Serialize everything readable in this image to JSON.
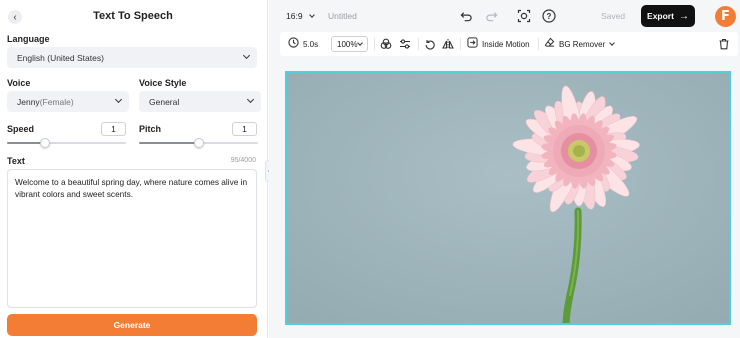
{
  "panel": {
    "title": "Text To Speech",
    "language_label": "Language",
    "language_value": "English (United States)",
    "voice_label": "Voice",
    "voice_name": "Jenny",
    "voice_gender": "(Female)",
    "voice_style_label": "Voice Style",
    "voice_style_value": "General",
    "speed_label": "Speed",
    "speed_value": "1",
    "pitch_label": "Pitch",
    "pitch_value": "1",
    "speed_level": 0.32,
    "pitch_level": 0.5,
    "text_label": "Text",
    "text_counter": "95/4000",
    "text_value": "Welcome to a beautiful spring day, where nature comes alive in vibrant colors and sweet scents.",
    "generate_label": "Generate"
  },
  "topbar": {
    "aspect_ratio": "16:9",
    "doc_title": "Untitled",
    "saved_label": "Saved",
    "export_label": "Export",
    "brand_letter": "F"
  },
  "toolbar": {
    "duration": "5.0s",
    "zoom": "100%",
    "inside_motion_label": "Inside Motion",
    "bg_remover_label": "BG Remover"
  },
  "colors": {
    "accent": "#f47d35",
    "selection": "#4fd1dc",
    "canvas_bg": "#9fb5bb"
  },
  "icons": [
    "back-icon",
    "chevron-down-icon",
    "undo-icon",
    "redo-icon",
    "screenshot-icon",
    "help-icon",
    "arrow-right-icon",
    "timer-icon",
    "color-icon",
    "adjust-icon",
    "rotate-icon",
    "flip-icon",
    "motion-icon",
    "eraser-icon",
    "trash-icon",
    "collapse-icon"
  ]
}
